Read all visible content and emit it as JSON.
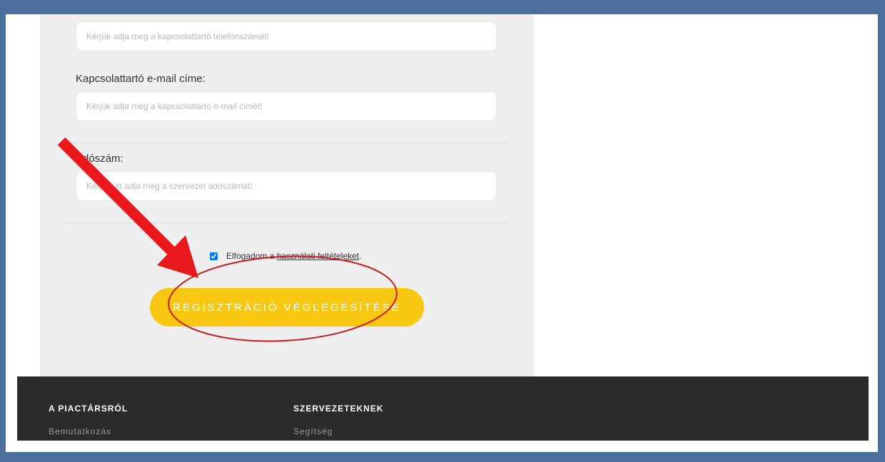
{
  "form": {
    "phone_placeholder": "Kérjük adja meg a kapcsolattartó telefonszámát!",
    "email_label": "Kapcsolattartó e-mail címe:",
    "email_placeholder": "Kérjük adja meg a kapcsolattartó e-mail címét!",
    "tax_label": "Adószám:",
    "tax_placeholder": "Kérjük, itt adja meg a szervezet adószámát!",
    "terms_prefix": "Elfogadom a ",
    "terms_link": "használati feltételeket",
    "terms_suffix": ".",
    "terms_checked": true,
    "submit_label": "REGISZTRÁCIÓ VÉGLEGESÍTÉSE"
  },
  "footer": {
    "columns": [
      {
        "heading": "A PIACTÁRSRÓL",
        "first_link": "Bemutatkozás"
      },
      {
        "heading": "SZERVEZETEKNEK",
        "first_link": "Segítség"
      }
    ]
  },
  "colors": {
    "frame": "#4a6f9a",
    "panel": "#efefef",
    "button": "#f7c712",
    "footer": "#2b2b2b",
    "annotation": "#e8181c"
  },
  "annotations": {
    "arrow_icon": "red-arrow-icon",
    "ellipse_icon": "red-ellipse-icon"
  }
}
